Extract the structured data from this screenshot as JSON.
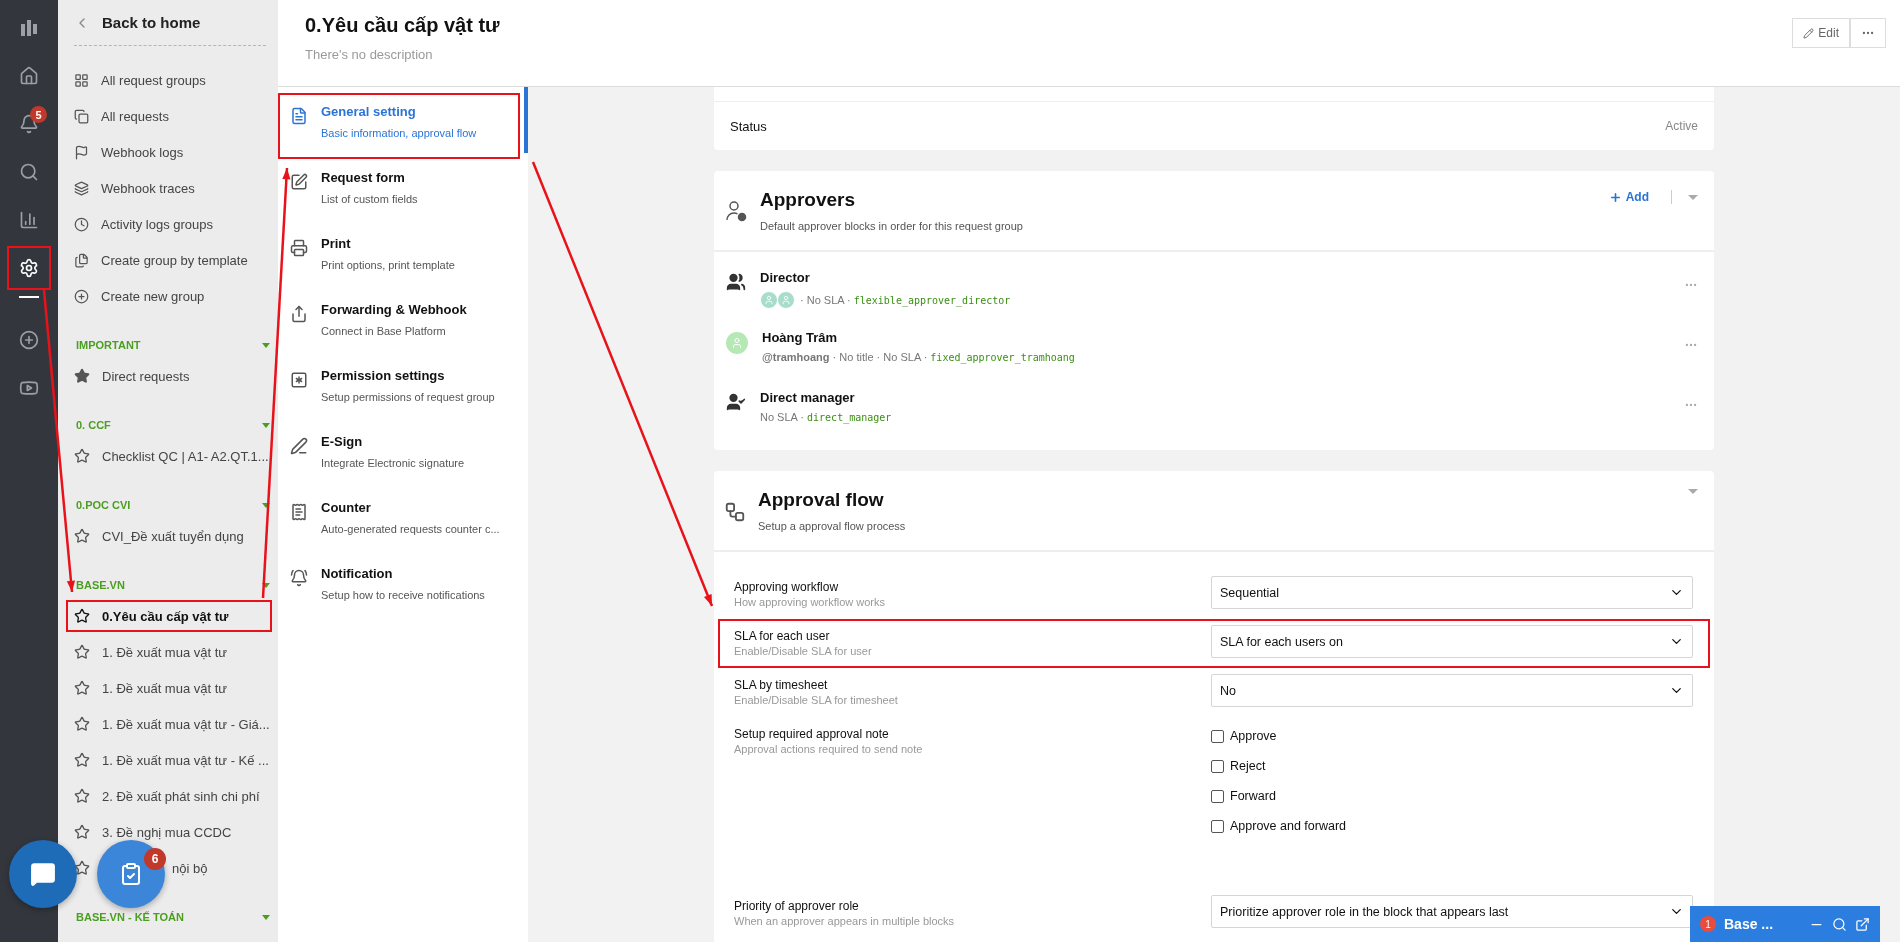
{
  "rail": {
    "items": [
      {
        "selected": false
      },
      {
        "selected": false
      },
      {
        "selected": false,
        "badge": "5"
      },
      {
        "selected": false
      },
      {
        "selected": false
      },
      {
        "selected": true
      },
      {
        "selected": false
      },
      {
        "selected": false
      }
    ]
  },
  "sidebar": {
    "back": "Back to home",
    "links": [
      {
        "label": "All request groups"
      },
      {
        "label": "All requests"
      },
      {
        "label": "Webhook logs"
      },
      {
        "label": "Webhook traces"
      },
      {
        "label": "Activity logs groups"
      },
      {
        "label": "Create group by template"
      },
      {
        "label": "Create new group"
      }
    ],
    "groups": [
      {
        "title": "IMPORTANT",
        "items": [
          {
            "label": "Direct requests",
            "starred": true,
            "selected": false
          }
        ]
      },
      {
        "title": "0. CCF",
        "items": [
          {
            "label": "Checklist QC | A1- A2.QT.1...",
            "starred": false,
            "selected": false
          }
        ]
      },
      {
        "title": "0.POC CVI",
        "items": [
          {
            "label": "CVI_Đề xuất tuyển dụng",
            "starred": false,
            "selected": false
          }
        ]
      },
      {
        "title": "BASE.VN",
        "items": [
          {
            "label": "0.Yêu cầu cấp vật tư",
            "starred": false,
            "selected": true
          },
          {
            "label": "1. Đề xuất mua vật tư",
            "starred": false,
            "selected": false
          },
          {
            "label": "1. Đề xuất mua vật tư",
            "starred": false,
            "selected": false
          },
          {
            "label": "1. Đề xuất mua vật tư - Giá...",
            "starred": false,
            "selected": false
          },
          {
            "label": "1. Đề xuất mua vật tư - Kế ...",
            "starred": false,
            "selected": false
          },
          {
            "label": "2. Đề xuất phát sinh chi phí",
            "starred": false,
            "selected": false
          },
          {
            "label": "3. Đề nghị mua CCDC",
            "starred": false,
            "selected": false
          },
          {
            "label": "nội bộ",
            "starred": false,
            "selected": false,
            "covered": true
          }
        ]
      },
      {
        "title": "BASE.VN - KẾ TOÁN"
      }
    ]
  },
  "header": {
    "title": "0.Yêu cầu cấp vật tư",
    "description": "There's no description",
    "edit": "Edit"
  },
  "settings_menu": [
    {
      "title": "General setting",
      "subtitle": "Basic information, approval flow",
      "selected": true
    },
    {
      "title": "Request form",
      "subtitle": "List of custom fields",
      "selected": false
    },
    {
      "title": "Print",
      "subtitle": "Print options, print template",
      "selected": false
    },
    {
      "title": "Forwarding & Webhook",
      "subtitle": "Connect in Base Platform",
      "selected": false
    },
    {
      "title": "Permission settings",
      "subtitle": "Setup permissions of request group",
      "selected": false
    },
    {
      "title": "E-Sign",
      "subtitle": "Integrate Electronic signature",
      "selected": false
    },
    {
      "title": "Counter",
      "subtitle": "Auto-generated requests counter c...",
      "selected": false
    },
    {
      "title": "Notification",
      "subtitle": "Setup how to receive notifications",
      "selected": false
    }
  ],
  "status": {
    "label": "Status",
    "value": "Active"
  },
  "approvers": {
    "title": "Approvers",
    "subtitle": "Default approver blocks in order for this request group",
    "add": "Add",
    "rows": [
      {
        "kind": "group",
        "name": "Director",
        "meta": "· No SLA ·",
        "code": "flexible_approver_director"
      },
      {
        "kind": "user",
        "name": "Hoàng Trâm",
        "handle": "@tramhoang",
        "meta": "· No title · No SLA ·",
        "code": "fixed_approver_tramhoang"
      },
      {
        "kind": "manager",
        "name": "Direct manager",
        "meta": "No SLA ·",
        "code": "direct_manager"
      }
    ]
  },
  "approval_flow": {
    "title": "Approval flow",
    "subtitle": "Setup a approval flow process",
    "rows": [
      {
        "kind": "select",
        "label": "Approving workflow",
        "hint": "How approving workflow works",
        "value": "Sequential"
      },
      {
        "kind": "select",
        "label": "SLA for each user",
        "hint": "Enable/Disable SLA for user",
        "value": "SLA for each users on"
      },
      {
        "kind": "select",
        "label": "SLA by timesheet",
        "hint": "Enable/Disable SLA for timesheet",
        "value": "No"
      },
      {
        "kind": "checks",
        "label": "Setup required approval note",
        "hint": "Approval actions required to send note",
        "options": [
          {
            "label": "Approve",
            "checked": false
          },
          {
            "label": "Reject",
            "checked": false
          },
          {
            "label": "Forward",
            "checked": false
          },
          {
            "label": "Approve and forward",
            "checked": false
          }
        ]
      },
      {
        "kind": "select",
        "label": "Priority of approver role",
        "hint": "When an approver appears in multiple blocks",
        "value": "Prioritize approver role in the block that appears last"
      }
    ]
  },
  "chat_widget": {
    "badge": "1",
    "title": "Base ..."
  },
  "task_button": {
    "badge": "6"
  }
}
